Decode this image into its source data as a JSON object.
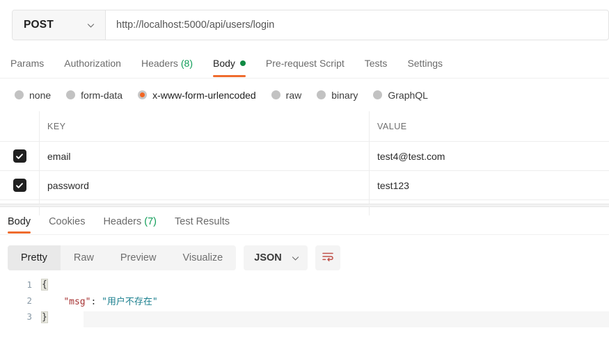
{
  "request_bar": {
    "method": "POST",
    "method_icon": "chevron-down-icon",
    "url": "http://localhost:5000/api/users/login"
  },
  "request_tabs": [
    {
      "label": "Params",
      "active": false
    },
    {
      "label": "Authorization",
      "active": false
    },
    {
      "label": "Headers",
      "badge": "(8)",
      "active": false
    },
    {
      "label": "Body",
      "dot": true,
      "active": true
    },
    {
      "label": "Pre-request Script",
      "active": false
    },
    {
      "label": "Tests",
      "active": false
    },
    {
      "label": "Settings",
      "active": false
    }
  ],
  "body_type_options": [
    {
      "label": "none",
      "selected": false
    },
    {
      "label": "form-data",
      "selected": false
    },
    {
      "label": "x-www-form-urlencoded",
      "selected": true
    },
    {
      "label": "raw",
      "selected": false
    },
    {
      "label": "binary",
      "selected": false
    },
    {
      "label": "GraphQL",
      "selected": false
    }
  ],
  "params_table": {
    "columns": {
      "key": "KEY",
      "value": "VALUE"
    },
    "rows": [
      {
        "checked": true,
        "key": "email",
        "value": "test4@test.com"
      },
      {
        "checked": true,
        "key": "password",
        "value": "test123"
      }
    ]
  },
  "response_tabs": [
    {
      "label": "Body",
      "active": true
    },
    {
      "label": "Cookies",
      "active": false
    },
    {
      "label": "Headers",
      "badge": "(7)",
      "active": false
    },
    {
      "label": "Test Results",
      "active": false
    }
  ],
  "view_toolbar": {
    "segments": [
      {
        "label": "Pretty",
        "active": true
      },
      {
        "label": "Raw",
        "active": false
      },
      {
        "label": "Preview",
        "active": false
      },
      {
        "label": "Visualize",
        "active": false
      }
    ],
    "format": "JSON",
    "format_icon": "chevron-down-icon",
    "wrap_icon": "word-wrap-icon"
  },
  "response_body": {
    "lines": [
      {
        "number": "1",
        "open_brace": "{"
      },
      {
        "number": "2",
        "indent": "    ",
        "key": "\"msg\"",
        "colon": ": ",
        "value": "\"用户不存在\""
      },
      {
        "number": "3",
        "close_brace": "}"
      }
    ]
  },
  "colors": {
    "accent_orange": "#ef6c2e",
    "radio_orange": "#f26522",
    "badge_green": "#0f9d58",
    "dot_green": "#0f8a43",
    "json_key_red": "#a63232",
    "json_string_teal": "#1a7f8e",
    "checkbox_dark": "#202020"
  }
}
